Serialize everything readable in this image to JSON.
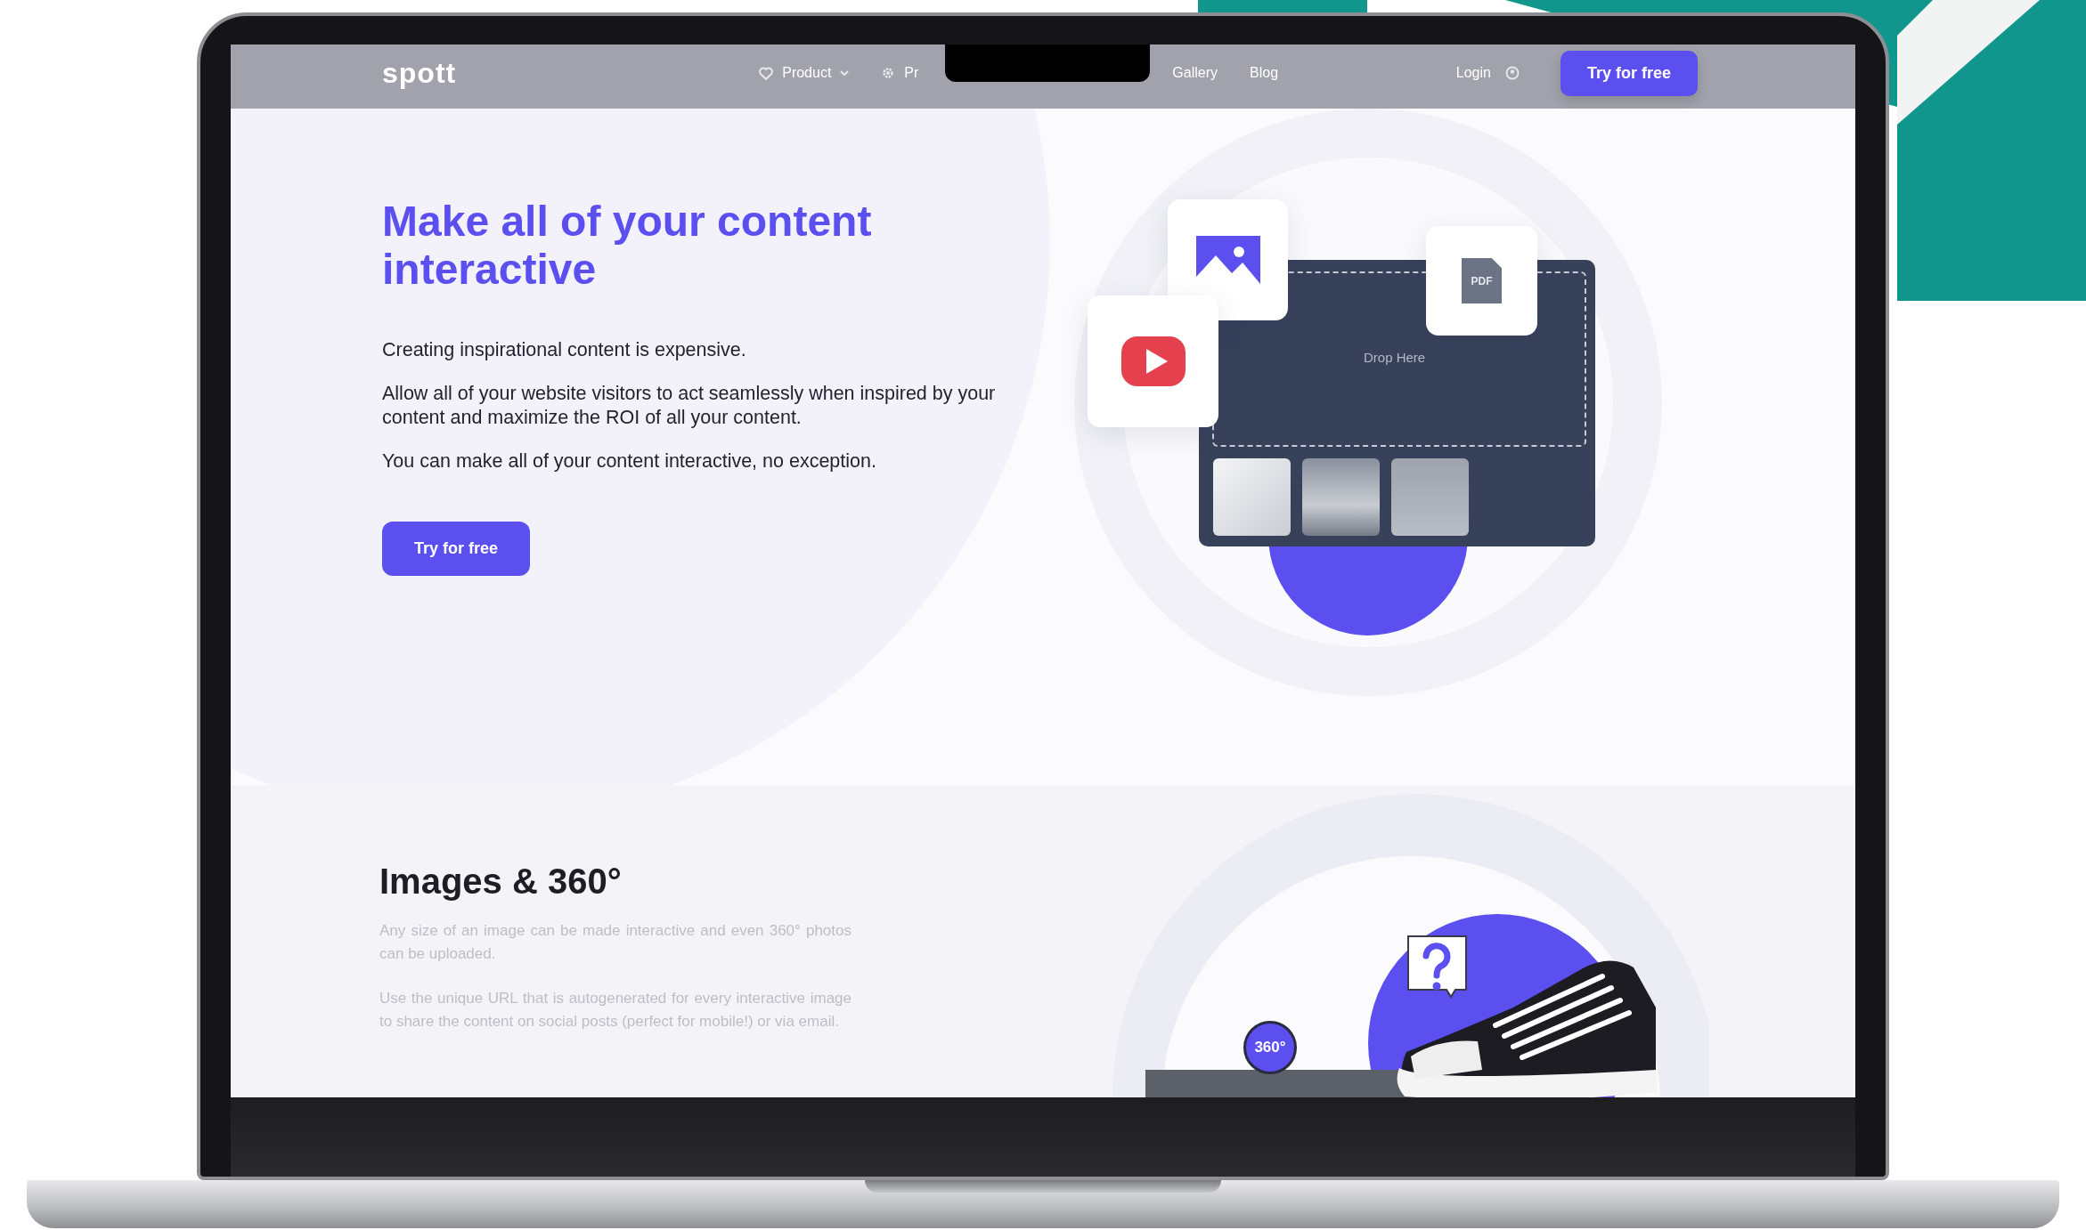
{
  "nav": {
    "logo": "spott",
    "items": [
      {
        "label": "Product",
        "kind": "favorite",
        "dropdown": true
      },
      {
        "label": "Pr",
        "kind": "settings",
        "dropdown": false
      },
      {
        "label": "Gallery",
        "kind": "plain",
        "dropdown": false
      },
      {
        "label": "Blog",
        "kind": "plain",
        "dropdown": false
      }
    ],
    "login": "Login",
    "cta": "Try for free"
  },
  "hero": {
    "title": "Make all of your content interactive",
    "paragraphs": [
      "Creating inspirational content is expensive.",
      "Allow all of your website visitors to act seamlessly when inspired by your content and maximize the ROI of all your content.",
      "You can make all of your content interactive, no exception."
    ],
    "button": "Try for free",
    "drop_label": "Drop Here",
    "pdf_label": "PDF"
  },
  "section": {
    "title": "Images & 360°",
    "paragraphs": [
      "Any size of an image can be made interactive and even 360° photos can be uploaded.",
      "Use the unique URL that is autogenerated for every interactive image to share the content on social posts (perfect for mobile!) or via email."
    ],
    "badge": "360°"
  }
}
